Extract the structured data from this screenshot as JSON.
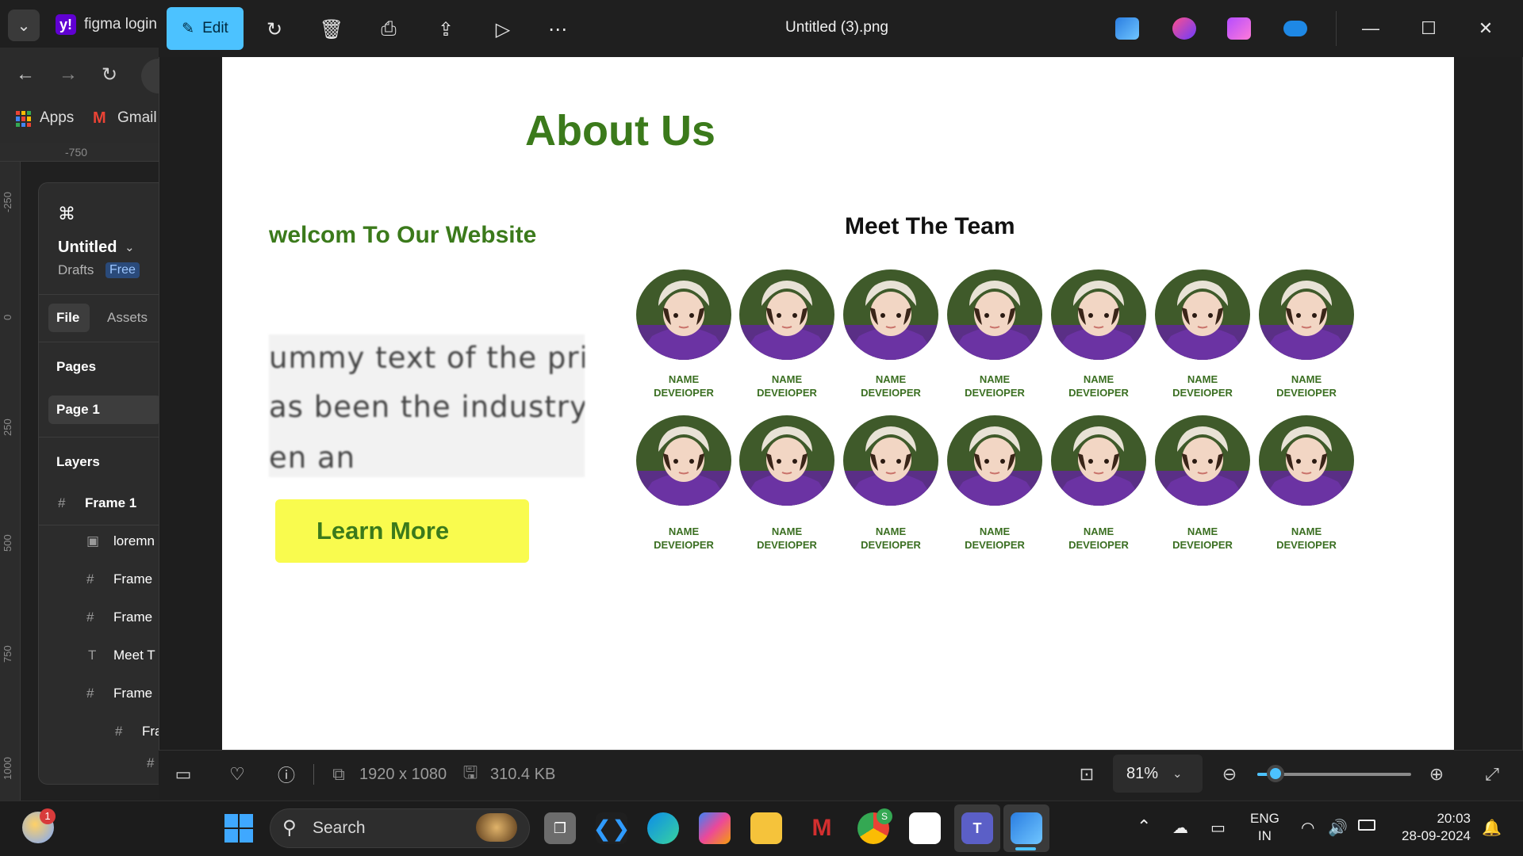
{
  "browser": {
    "tab_title": "figma login",
    "bookmarks": [
      {
        "label": "Apps"
      },
      {
        "label": "Gmail"
      }
    ]
  },
  "figma": {
    "ruler_top_label": "-750",
    "ruler_left_labels": [
      "-250",
      "0",
      "250",
      "500",
      "750",
      "1000"
    ],
    "file_name": "Untitled",
    "drafts_label": "Drafts",
    "plan_badge": "Free",
    "tabs": {
      "file": "File",
      "assets": "Assets"
    },
    "pages_heading": "Pages",
    "page_item": "Page 1",
    "layers_heading": "Layers",
    "layers": [
      {
        "label": "Frame 1",
        "icon": "frame-icon"
      },
      {
        "label": "loremn",
        "icon": "image-icon"
      },
      {
        "label": "Frame",
        "icon": "frame-icon"
      },
      {
        "label": "Frame",
        "icon": "frame-icon"
      },
      {
        "label": "Meet T",
        "icon": "text-icon"
      },
      {
        "label": "Frame",
        "icon": "frame-icon"
      },
      {
        "label": "Fra",
        "icon": "frame-icon"
      }
    ]
  },
  "viewer": {
    "edit_label": "Edit",
    "file_title": "Untitled (3).png",
    "dimensions": "1920 x 1080",
    "file_size": "310.4 KB",
    "zoom_level": "81%",
    "zoom_slider_fraction": 0.12
  },
  "image": {
    "heading": "About Us",
    "welcome": "welcom To Our Website",
    "lorem_lines": [
      "ummy text of the printi",
      "as been the industry's s",
      "en an"
    ],
    "cta_label": "Learn More",
    "team_heading": "Meet The Team",
    "member_name": "NAME",
    "member_role": "DEVEIOPER",
    "member_count": 14
  },
  "taskbar": {
    "notification_count": "1",
    "search_placeholder": "Search",
    "chrome_badge": "S",
    "lang_1": "ENG",
    "lang_2": "IN",
    "time": "20:03",
    "date": "28-09-2024"
  },
  "colors": {
    "accent": "#4cc2ff",
    "heading_green": "#3b7a1b",
    "cta_yellow": "#f9fb4e"
  }
}
